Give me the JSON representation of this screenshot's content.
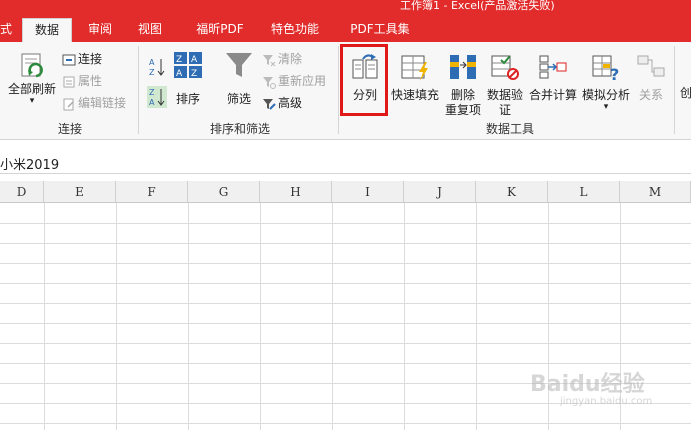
{
  "window": {
    "title": "工作簿1 -  Excel(产品激活失败)"
  },
  "tabs": [
    {
      "label": "式"
    },
    {
      "label": "数据"
    },
    {
      "label": "审阅"
    },
    {
      "label": "视图"
    },
    {
      "label": "福昕PDF"
    },
    {
      "label": "特色功能"
    },
    {
      "label": "PDF工具集"
    }
  ],
  "ribbon": {
    "connections": {
      "group_label": "连接",
      "refresh_all": "全部刷新",
      "connections": "连接",
      "properties": "属性",
      "edit_links": "编辑链接"
    },
    "sort_filter": {
      "group_label": "排序和筛选",
      "sort": "排序",
      "filter": "筛选",
      "clear": "清除",
      "reapply": "重新应用",
      "advanced": "高级"
    },
    "data_tools": {
      "group_label": "数据工具",
      "text_to_columns": "分列",
      "flash_fill": "快速填充",
      "remove_dup_line1": "删除",
      "remove_dup_line2": "重复项",
      "data_validation_line1": "数据验",
      "data_validation_line2": "证",
      "consolidate": "合并计算",
      "what_if": "模拟分析",
      "relationships": "关系"
    },
    "next_group_partial": "创"
  },
  "formula_bar": {
    "content": "小米2019"
  },
  "grid": {
    "columns": [
      "D",
      "E",
      "F",
      "G",
      "H",
      "I",
      "J",
      "K",
      "L",
      "M"
    ]
  },
  "watermark": {
    "main": "Baidu经验",
    "sub": "jingyan.baidu.com"
  },
  "colors": {
    "accent": "#e22b2b",
    "highlight": "#e01818"
  }
}
